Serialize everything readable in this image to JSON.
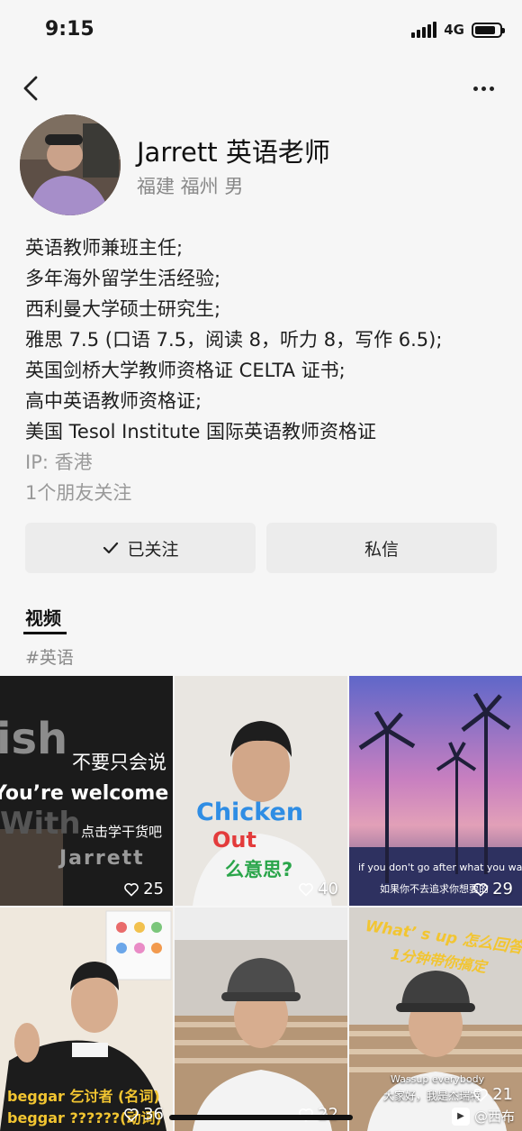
{
  "status_bar": {
    "time": "9:15",
    "network": "4G"
  },
  "profile": {
    "name": "Jarrett 英语老师",
    "location": "福建 福州 男",
    "bio": [
      "英语教师兼班主任;",
      "多年海外留学生活经验;",
      "西利曼大学硕士研究生;",
      "雅思 7.5 (口语 7.5，阅读 8，听力 8，写作 6.5);",
      "英国剑桥大学教师资格证 CELTA 证书;",
      "高中英语教师资格证;",
      "美国 Tesol Institute 国际英语教师资格证"
    ],
    "ip": "IP: 香港",
    "friends_following": "1个朋友关注"
  },
  "actions": {
    "follow_label": "已关注",
    "message_label": "私信"
  },
  "tabs": {
    "video_label": "视频",
    "tag": "#英语"
  },
  "videos": [
    {
      "likes": "25",
      "texts": [
        "ish",
        "不要只会说",
        "You’re welcome",
        "With",
        "点击学干货吧",
        "Jarrett"
      ]
    },
    {
      "likes": "40",
      "texts": [
        "Chicken",
        "Out",
        "么意思?"
      ]
    },
    {
      "likes": "29",
      "texts": [
        "if you don't go after what you want",
        "如果你不去追求你想要的"
      ]
    },
    {
      "likes": "36",
      "texts": [
        "beggar 乞讨者 (名词)",
        "beggar ??????(动词)"
      ]
    },
    {
      "likes": "22",
      "texts": []
    },
    {
      "likes": "21",
      "texts": [
        "What’ s up 怎么回答?",
        "1分钟带你搞定",
        "Wassup everybody",
        "大家好，我是杰瑞特"
      ]
    }
  ],
  "watermark": "@西布"
}
